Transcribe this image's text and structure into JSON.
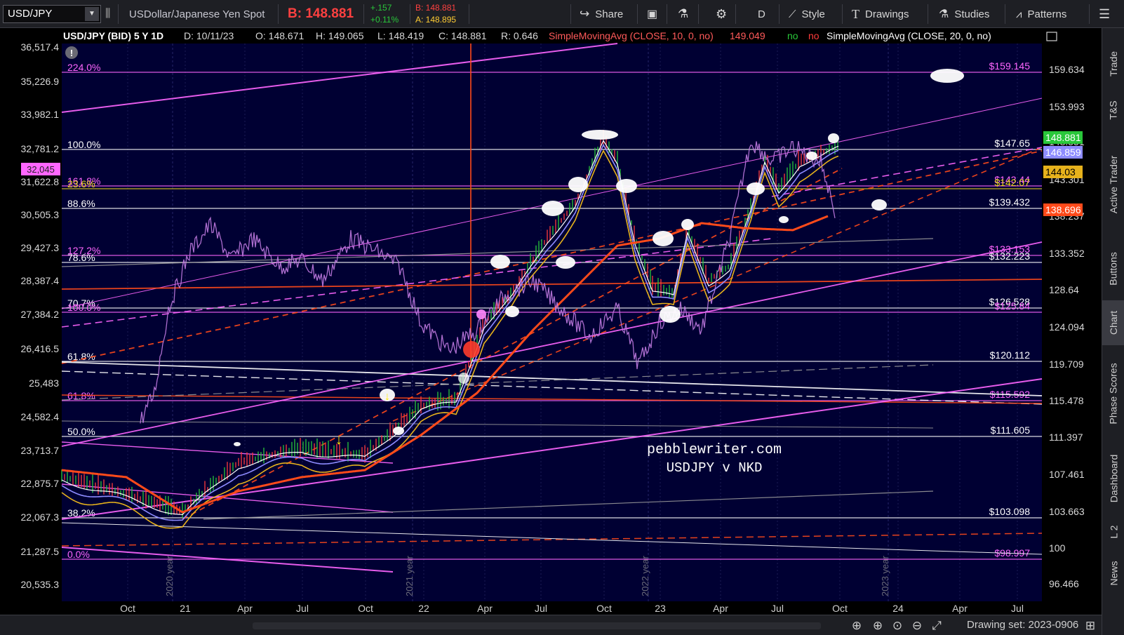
{
  "toolbar": {
    "symbol": "USD/JPY",
    "description": "USDollar/Japanese Yen Spot",
    "bid": "B: 148.881",
    "change": "+.157",
    "change_pct": "+0.11%",
    "bid_small": "B: 148.881",
    "ask_small": "A: 148.895",
    "share": "Share",
    "aggregation": "D",
    "style": "Style",
    "drawings": "Drawings",
    "studies": "Studies",
    "patterns": "Patterns",
    "icons": [
      "dropdown-icon",
      "link-icon",
      "share-icon",
      "projector-icon",
      "flask-icon",
      "gear-icon",
      "style-icon",
      "drawings-icon",
      "studies-icon",
      "patterns-icon",
      "menu-icon"
    ]
  },
  "chart_header": {
    "title": "USD/JPY (BID) 5 Y 1D",
    "date": "D: 10/11/23",
    "open": "O: 148.671",
    "high": "H: 149.065",
    "low": "L: 148.419",
    "close": "C: 148.881",
    "range": "R: 0.646",
    "sma10": "SimpleMovingAvg (CLOSE, 10, 0, no)",
    "sma10_val": "149.049",
    "no1": "no",
    "no2": "no",
    "sma20": "SimpleMovingAvg (CLOSE, 20, 0, no)"
  },
  "left_axis": {
    "ticks": [
      "36,517.4",
      "35,226.9",
      "33,982.1",
      "32,781.2",
      "31,622.8",
      "30,505.3",
      "29,427.3",
      "28,387.4",
      "27,384.2",
      "26,416.5",
      "25,483",
      "24,582.4",
      "23,713.7",
      "22,875.7",
      "22,067.3",
      "21,287.5",
      "20,535.3"
    ],
    "badge": "32,045"
  },
  "right_axis": {
    "ticks": [
      "159.634",
      "153.993",
      "148.551",
      "143.301",
      "138.237",
      "133.352",
      "128.64",
      "124.094",
      "119.709",
      "115.478",
      "111.397",
      "107.461",
      "103.663",
      "100",
      "96.466"
    ],
    "badges": [
      {
        "label": "148.881",
        "color": "#29c73a"
      },
      {
        "label": "146.859",
        "color": "#8e8cff"
      },
      {
        "label": "144.03",
        "color": "#e7b21c"
      },
      {
        "label": "138.696",
        "color": "#ff4a1a"
      }
    ]
  },
  "fib_levels_left": [
    {
      "label": "224.0%",
      "color": "#ff66ff"
    },
    {
      "label": "100.0%",
      "color": "#ffffff"
    },
    {
      "label": "161.8%",
      "color": "#ff66ff"
    },
    {
      "label": "23.6%",
      "color": "#e7d21c"
    },
    {
      "label": "88.6%",
      "color": "#ffffff"
    },
    {
      "label": "127.2%",
      "color": "#ff66ff"
    },
    {
      "label": "78.6%",
      "color": "#ffffff"
    },
    {
      "label": "70.7%",
      "color": "#ffffff"
    },
    {
      "label": "100.0%",
      "color": "#ff66ff"
    },
    {
      "label": "61.8%",
      "color": "#ffffff"
    },
    {
      "label": "61.8%",
      "color": "#ff66ff"
    },
    {
      "label": "50.0%",
      "color": "#ffffff"
    },
    {
      "label": "38.2%",
      "color": "#ffffff"
    },
    {
      "label": "0.0%",
      "color": "#ff66ff"
    }
  ],
  "fib_levels_right": [
    {
      "label": "$159.145",
      "color": "#ff66ff"
    },
    {
      "label": "$147.65",
      "color": "#ffffff"
    },
    {
      "label": "$143.44",
      "color": "#ff66ff"
    },
    {
      "label": "$142.07",
      "color": "#e7d21c"
    },
    {
      "label": "$139.432",
      "color": "#ffffff"
    },
    {
      "label": "$133.153",
      "color": "#ff66ff"
    },
    {
      "label": "$132.223",
      "color": "#ffffff"
    },
    {
      "label": "$126.528",
      "color": "#ffffff"
    },
    {
      "label": "$125.84",
      "color": "#ff66ff"
    },
    {
      "label": "$120.112",
      "color": "#ffffff"
    },
    {
      "label": "$115.592",
      "color": "#ff66ff"
    },
    {
      "label": "$111.605",
      "color": "#ffffff"
    },
    {
      "label": "$103.098",
      "color": "#ffffff"
    },
    {
      "label": "$98.997",
      "color": "#ff66ff"
    }
  ],
  "x_axis": [
    "Oct",
    "21",
    "Apr",
    "Jul",
    "Oct",
    "22",
    "Apr",
    "Jul",
    "Oct",
    "23",
    "Apr",
    "Jul",
    "Oct",
    "24",
    "Apr",
    "Jul"
  ],
  "year_marks": [
    "2020 year",
    "2021 year",
    "2022 year",
    "2023 year"
  ],
  "watermark": {
    "line1": "pebblewriter.com",
    "line2": "USDJPY v NKD"
  },
  "sidebar_tabs": [
    "Trade",
    "T&S",
    "Active Trader",
    "Buttons",
    "Chart",
    "Phase Scores",
    "Dashboard",
    "L 2",
    "News"
  ],
  "bottom": {
    "drawing_set": "Drawing set: 2023-0906",
    "icons": [
      "zoom-in-icon",
      "crosshair-icon",
      "zoom-search-icon",
      "zoom-out-icon",
      "expand-icon",
      "grid-icon"
    ]
  },
  "colors": {
    "chart_bg": "#000033",
    "sma_short": "#ffffff",
    "sma_mid": "#8e8cff",
    "sma_long": "#e7b21c",
    "sma_200": "#ff4a1a",
    "nikkei": "#c07ae0",
    "fib_pink": "#ff66ff"
  }
}
